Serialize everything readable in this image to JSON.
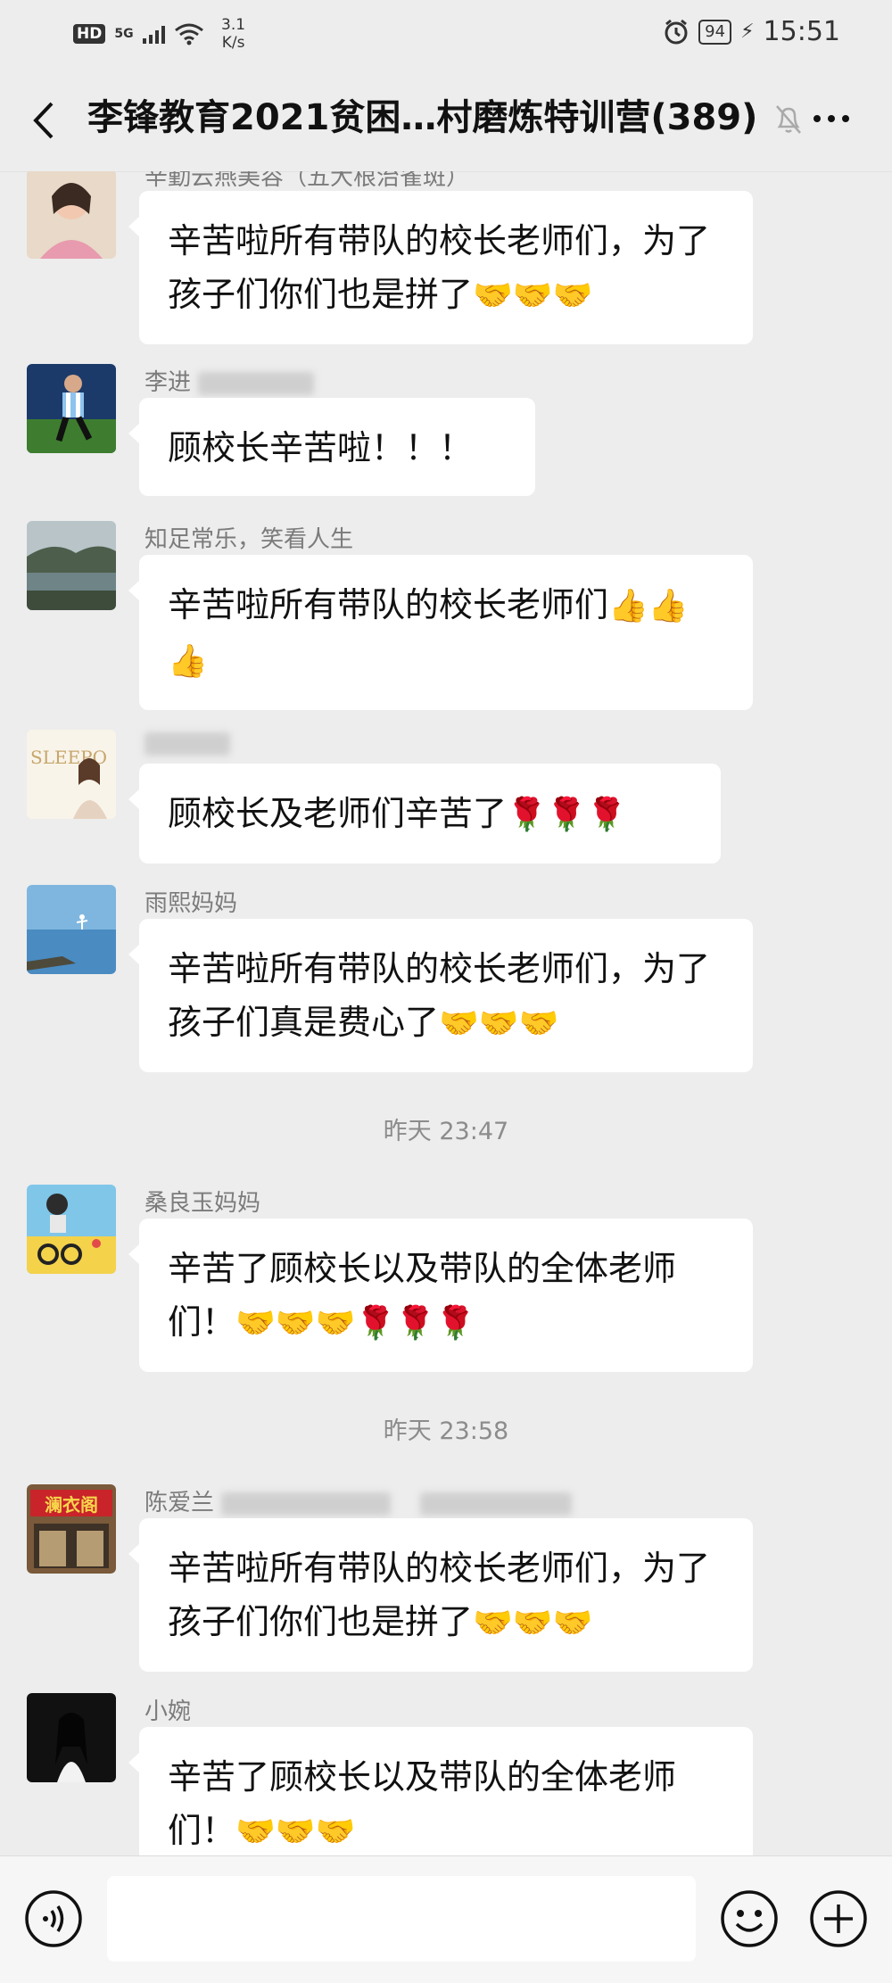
{
  "status_bar": {
    "hd": "HD",
    "network": "5G",
    "speed": "3.1 K/s",
    "battery": "94",
    "time": "15:51"
  },
  "header": {
    "title": "李锋教育2021贫困…村磨炼特训营(389)"
  },
  "messages": [
    {
      "nickname": "辛勤云燕美容（五大根治雀斑）",
      "text": "辛苦啦所有带队的校长老师们，为了孩子们你们也是拼了",
      "emoji": "🤝🤝🤝"
    },
    {
      "nickname": "李进",
      "text": "顾校长辛苦啦！！！",
      "emoji": ""
    },
    {
      "nickname": "知足常乐，笑看人生",
      "text": "辛苦啦所有带队的校长老师们",
      "emoji": "👍👍👍"
    },
    {
      "nickname": "",
      "text": "顾校长及老师们辛苦了",
      "emoji": "🌹🌹🌹"
    },
    {
      "nickname": "雨熙妈妈",
      "text": "辛苦啦所有带队的校长老师们，为了孩子们真是费心了",
      "emoji": "🤝🤝🤝"
    },
    {
      "nickname": "桑良玉妈妈",
      "text": "辛苦了顾校长以及带队的全体老师们！",
      "emoji": "🤝🤝🤝🌹🌹🌹"
    },
    {
      "nickname": "陈爱兰",
      "text": "辛苦啦所有带队的校长老师们，为了孩子们你们也是拼了",
      "emoji": "🤝🤝🤝"
    },
    {
      "nickname": "小婉",
      "text": "辛苦了顾校长以及带队的全体老师们！",
      "emoji": "🤝🤝🤝"
    }
  ],
  "time_separators": [
    "昨天 23:47",
    "昨天 23:58"
  ],
  "avatars": {
    "m0": "pink-portrait-avatar",
    "m1": "soccer-player-avatar",
    "m2": "lake-mountain-avatar",
    "m3": "sleepo-ad-avatar",
    "m4": "blue-sea-avatar",
    "m5": "kid-bike-avatar",
    "m6": "shop-sign-avatar",
    "m7": "dark-portrait-avatar"
  },
  "avatar_sign_text": "澜衣阁",
  "avatar_brand_text": "SLEEPO"
}
